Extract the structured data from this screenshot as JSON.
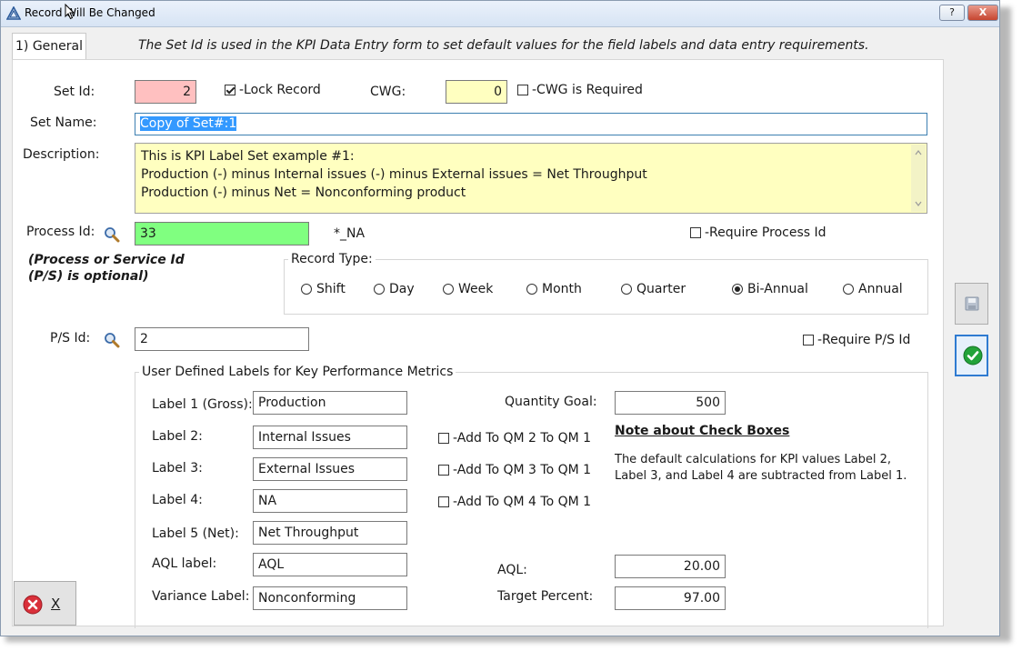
{
  "window": {
    "title": "Record Will Be Changed",
    "help_label": "?",
    "close_label": "X"
  },
  "tab": {
    "label": "1) General",
    "description": "The Set Id is used in the KPI Data Entry form to set default values for the field labels and data entry requirements."
  },
  "form": {
    "set_id": {
      "label": "Set Id:",
      "value": "2"
    },
    "lock_record": {
      "label": "-Lock Record",
      "checked": true
    },
    "cwg": {
      "label": "CWG:",
      "value": "0"
    },
    "cwg_required": {
      "label": "-CWG is Required",
      "checked": false
    },
    "set_name": {
      "label": "Set Name:",
      "value": "Copy of Set#:1"
    },
    "description": {
      "label": "Description:",
      "lines": [
        "This is KPI Label Set example #1:",
        "Production (-) minus Internal issues (-) minus External issues = Net Throughput",
        "Production (-) minus Net = Nonconforming product"
      ]
    },
    "process_id": {
      "label": "Process Id:",
      "value": "33",
      "name": "*_NA"
    },
    "require_process_id": {
      "label": "-Require Process Id",
      "checked": false
    },
    "ps_note": [
      "(Process or Service Id",
      "(P/S) is optional)"
    ],
    "record_type": {
      "label": "Record Type:",
      "options": [
        "Shift",
        "Day",
        "Week",
        "Month",
        "Quarter",
        "Bi-Annual",
        "Annual"
      ],
      "selected": "Bi-Annual"
    },
    "ps_id": {
      "label": "P/S Id:",
      "value": "2"
    },
    "require_ps_id": {
      "label": "-Require P/S Id",
      "checked": false
    }
  },
  "labels_group": {
    "title": "User Defined Labels for Key Performance Metrics",
    "label1": {
      "label": "Label 1 (Gross):",
      "value": "Production"
    },
    "label2": {
      "label": "Label 2:",
      "value": "Internal Issues"
    },
    "label3": {
      "label": "Label 3:",
      "value": "External Issues"
    },
    "label4": {
      "label": "Label 4:",
      "value": "NA"
    },
    "label5": {
      "label": "Label 5 (Net):",
      "value": "Net Throughput"
    },
    "aql_label": {
      "label": "AQL label:",
      "value": "AQL"
    },
    "variance_label": {
      "label": "Variance Label:",
      "value": "Nonconforming"
    },
    "add_qm2": {
      "label": "-Add To QM 2 To QM 1",
      "checked": false
    },
    "add_qm3": {
      "label": "-Add To QM 3 To QM 1",
      "checked": false
    },
    "add_qm4": {
      "label": "-Add To QM 4 To QM 1",
      "checked": false
    },
    "quantity_goal": {
      "label": "Quantity Goal:",
      "value": "500"
    },
    "note_title": "Note about Check Boxes",
    "note_lines": [
      "The default calculations for KPI values Label 2,",
      "Label 3, and Label 4 are subtracted from Label 1."
    ],
    "aql": {
      "label": "AQL:",
      "value": "20.00"
    },
    "target_percent": {
      "label": "Target Percent:",
      "value": "97.00"
    }
  },
  "buttons": {
    "cancel_label": "X"
  },
  "colors": {
    "set_id_bg": "#ffc0c0",
    "cwg_bg": "#ffffc0",
    "description_bg": "#ffffc0",
    "process_id_bg": "#80ff80",
    "selection_bg": "#3399ff",
    "ok_green": "#22a33a",
    "cancel_red": "#d9303a"
  }
}
